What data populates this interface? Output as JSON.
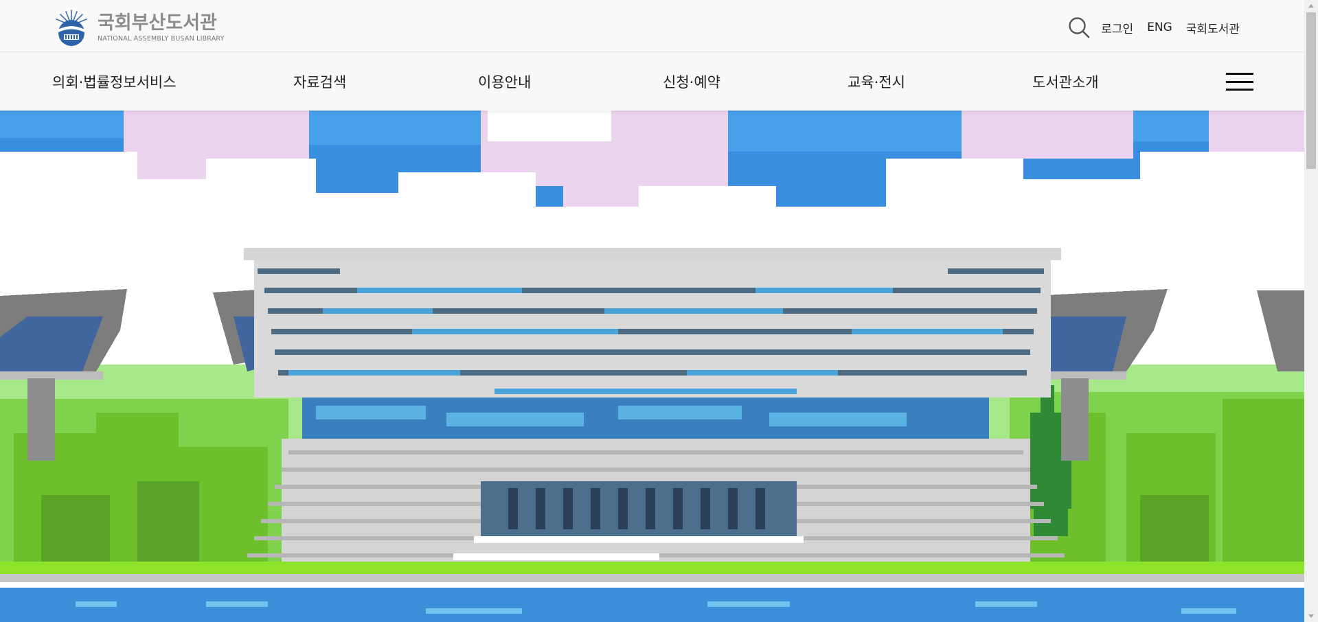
{
  "logo": {
    "name_ko": "국회부산도서관",
    "name_en": "NATIONAL ASSEMBLY BUSAN LIBRARY"
  },
  "utility": {
    "search_icon": "search-icon",
    "login": "로그인",
    "eng": "ENG",
    "national_library": "국회도서관"
  },
  "nav": {
    "items": [
      {
        "label": "의회·법률정보서비스"
      },
      {
        "label": "자료검색"
      },
      {
        "label": "이용안내"
      },
      {
        "label": "신청·예약"
      },
      {
        "label": "교육·전시"
      },
      {
        "label": "도서관소개"
      }
    ],
    "menu_icon": "hamburger-menu-icon"
  },
  "hero": {
    "image": "pixel-art-library-building",
    "colors": {
      "sky": "#3a8ee0",
      "cloud_pink": "#ecd3ef",
      "grass": "#8ee42a",
      "water": "#3b8fd8"
    }
  }
}
